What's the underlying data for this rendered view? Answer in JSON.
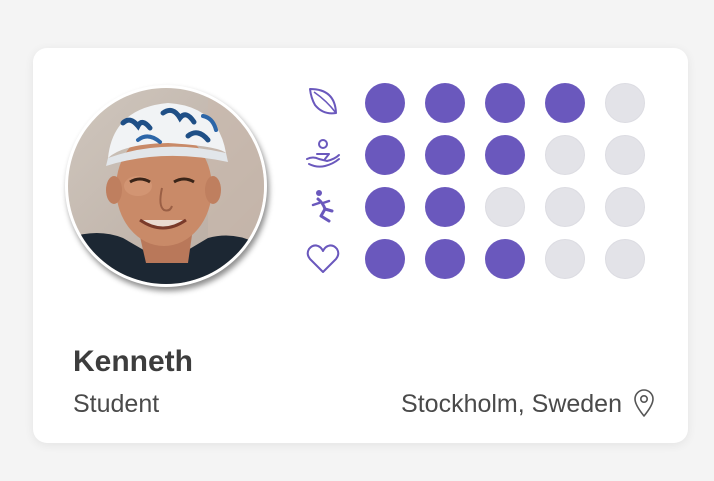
{
  "profile": {
    "name": "Kenneth",
    "role": "Student",
    "location": "Stockholm, Sweden",
    "avatar_icon": "profile-photo"
  },
  "colors": {
    "accent": "#6a58bd",
    "inactive": "#e3e3e8",
    "background": "#f4f4f4",
    "card": "#ffffff"
  },
  "ratings": [
    {
      "icon": "leaf-icon",
      "filled": 4,
      "total": 5
    },
    {
      "icon": "hand-giving-icon",
      "filled": 3,
      "total": 5
    },
    {
      "icon": "person-falling-icon",
      "filled": 2,
      "total": 5
    },
    {
      "icon": "heart-icon",
      "filled": 3,
      "total": 5
    }
  ],
  "location_icon": "map-pin-icon"
}
